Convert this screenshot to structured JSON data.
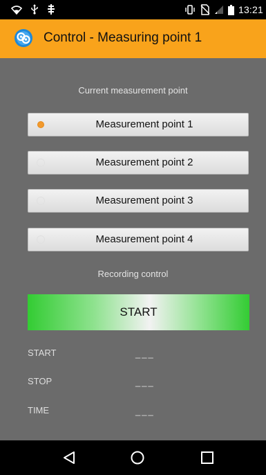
{
  "status_bar": {
    "time": "13:21",
    "icons_left": [
      "wifi-icon",
      "usb-icon",
      "notification-icon"
    ],
    "icons_right": [
      "vibrate-icon",
      "no-sim-icon",
      "signal-icon",
      "battery-icon"
    ]
  },
  "app_bar": {
    "title": "Control - Measuring point 1",
    "logo": "app-logo-icon",
    "background_color": "#f9a31b"
  },
  "measurement": {
    "section_label": "Current measurement point",
    "selected_index": 0,
    "points": [
      {
        "label": "Measurement point 1",
        "checked": true
      },
      {
        "label": "Measurement point 2",
        "checked": false
      },
      {
        "label": "Measurement point 3",
        "checked": false
      },
      {
        "label": "Measurement point 4",
        "checked": false
      }
    ]
  },
  "recording": {
    "section_label": "Recording control",
    "start_button_label": "START",
    "rows": [
      {
        "label": "START",
        "value": "___"
      },
      {
        "label": "STOP",
        "value": "___"
      },
      {
        "label": "TIME",
        "value": "___"
      }
    ]
  },
  "nav_bar": {
    "buttons": [
      "back-icon",
      "home-icon",
      "recents-icon"
    ]
  },
  "colors": {
    "content_background": "#6b6b6b",
    "radio_checked": "#f29a2e",
    "start_button_green": "#33cc33"
  }
}
